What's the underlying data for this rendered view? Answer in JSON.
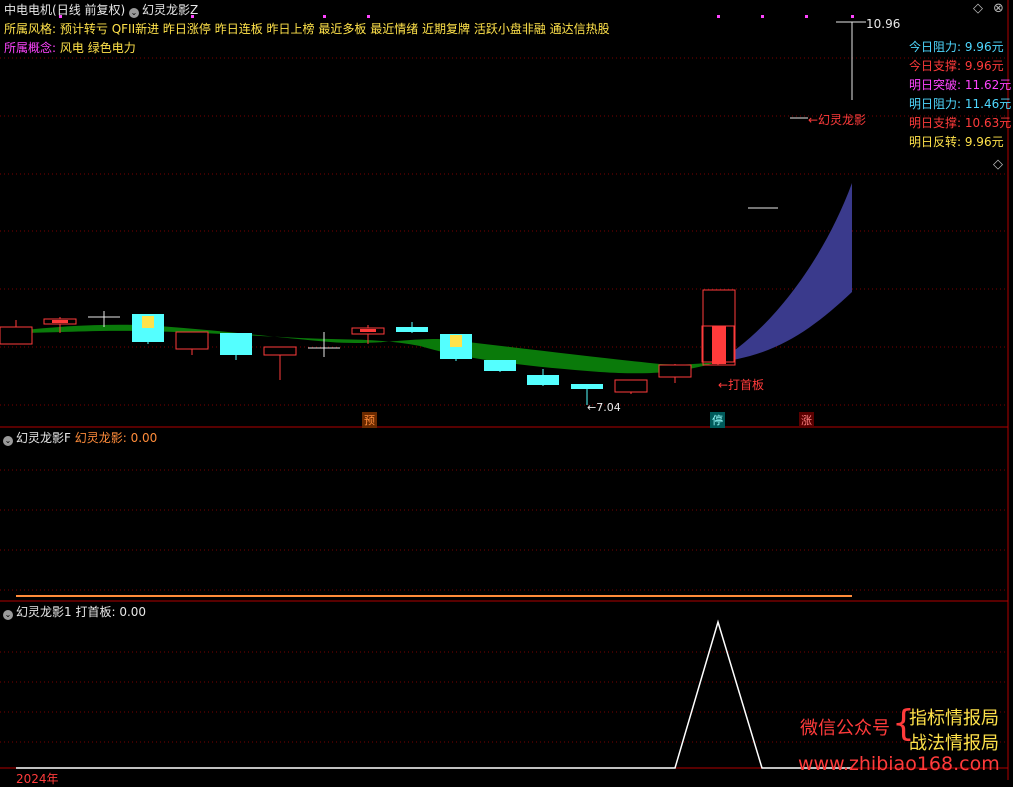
{
  "header": {
    "stock_name": "中电电机",
    "period": "(日线 前复权)",
    "indicator": "幻灵龙影Z"
  },
  "styles": {
    "label": "所属风格:",
    "value": "预计转亏 QFII新进 昨日涨停 昨日连板 昨日上榜 最近多板 最近情绪 近期复牌 活跃小盘非融 通达信热股"
  },
  "concepts": {
    "label": "所属概念:",
    "value": "风电 绿色电力"
  },
  "levels": [
    {
      "label": "今日阻力:",
      "value": "9.96",
      "unit": "元",
      "color": "#4fd8ff"
    },
    {
      "label": "今日支撑:",
      "value": "9.96",
      "unit": "元",
      "color": "#ff3b3b"
    },
    {
      "label": "明日突破:",
      "value": "11.62",
      "unit": "元",
      "color": "#ff44ff"
    },
    {
      "label": "明日阻力:",
      "value": "11.46",
      "unit": "元",
      "color": "#4fd8ff"
    },
    {
      "label": "明日支撑:",
      "value": "10.63",
      "unit": "元",
      "color": "#ff3b3b"
    },
    {
      "label": "明日反转:",
      "value": "9.96",
      "unit": "元",
      "color": "#ffe24a"
    }
  ],
  "annotations": {
    "high_label": "10.96",
    "dragon_label": "←幻灵龙影",
    "low_label": "←7.04",
    "first_board": "←打首板",
    "tag_yu": "预",
    "tag_ting": "停",
    "tag_zhang": "涨"
  },
  "panel_f": {
    "name": "幻灵龙影F",
    "series": "幻灵龙影: 0.00"
  },
  "panel_1": {
    "name": "幻灵龙影1",
    "series": "打首板: 0.00"
  },
  "year_label": "2024年",
  "watermark": {
    "wechat": "微信公众号",
    "line1": "指标情报局",
    "line2": "战法情报局",
    "url": "www.zhibiao168.com"
  },
  "colors": {
    "up": "#ff3b3b",
    "down": "#54ffff",
    "band_down": "#0a7a0a",
    "band_up": "#3a3a8c",
    "grid": "#7a0000"
  }
}
